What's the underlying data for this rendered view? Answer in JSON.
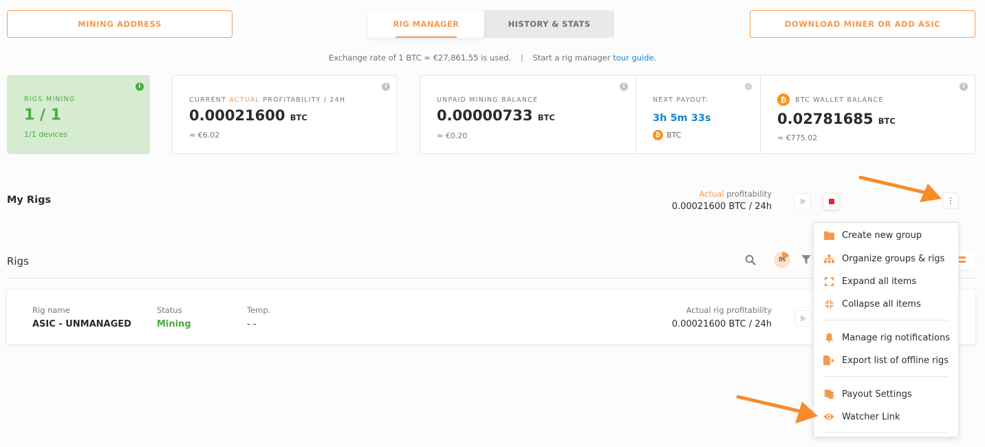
{
  "header": {
    "mining_address_label": "MINING ADDRESS",
    "download_label": "DOWNLOAD MINER OR ADD ASIC",
    "tabs": [
      {
        "label": "RIG MANAGER",
        "active": true
      },
      {
        "label": "HISTORY & STATS",
        "active": false
      }
    ],
    "exchange_text": "Exchange rate of 1 BTC ≈ €27,861.55 is used.",
    "separator": "|",
    "tour_prefix": "Start a rig manager",
    "tour_link": "tour guide",
    "tour_suffix": "."
  },
  "stats": {
    "rigs_mining": {
      "label": "RIGS MINING",
      "value": "1 / 1",
      "sub": "1/1 devices"
    },
    "profitability": {
      "label_pre": "CURRENT ",
      "label_hl": "ACTUAL",
      "label_post": " PROFITABILITY / 24H",
      "value": "0.00021600",
      "unit": "BTC",
      "fiat": "≈ €6.02"
    },
    "unpaid": {
      "label": "UNPAID MINING BALANCE",
      "value": "0.00000733",
      "unit": "BTC",
      "fiat": "≈ €0.20"
    },
    "next_payout": {
      "label": "NEXT PAYOUT:",
      "value": "3h 5m 33s",
      "currency": "BTC"
    },
    "wallet": {
      "label": "BTC WALLET BALANCE",
      "value": "0.02781685",
      "unit": "BTC",
      "fiat": "≈ €775.02"
    }
  },
  "my_rigs": {
    "title": "My Rigs",
    "profit_label_hl": "Actual",
    "profit_label_rest": " profitability",
    "profit_value": "0.00021600 BTC / 24h"
  },
  "rigs": {
    "title": "Rigs",
    "timer": "8s",
    "row": {
      "name_label": "Rig name",
      "name": "ASIC - UNMANAGED",
      "status_label": "Status",
      "status": "Mining",
      "temp_label": "Temp.",
      "temp": "- -",
      "profit_label": "Actual rig profitability",
      "profit": "0.00021600 BTC / 24h"
    }
  },
  "menu": {
    "items": [
      {
        "label": "Create new group",
        "icon": "folder-icon"
      },
      {
        "label": "Organize groups & rigs",
        "icon": "hierarchy-icon"
      },
      {
        "label": "Expand all items",
        "icon": "expand-icon"
      },
      {
        "label": "Collapse all items",
        "icon": "collapse-icon"
      },
      {
        "label": "Manage rig notifications",
        "icon": "bell-icon"
      },
      {
        "label": "Export list of offline rigs",
        "icon": "export-file-icon"
      },
      {
        "label": "Payout Settings",
        "icon": "coins-icon"
      },
      {
        "label": "Watcher Link",
        "icon": "eye-icon"
      }
    ]
  },
  "colors": {
    "accent": "#f7994a",
    "green": "#4bab3f",
    "blue": "#1a84c9",
    "stop": "#e8242c"
  }
}
